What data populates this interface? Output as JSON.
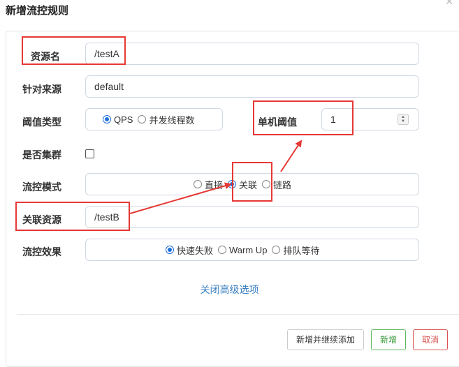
{
  "dialog": {
    "title": "新增流控规则"
  },
  "form": {
    "resource_name": {
      "label": "资源名",
      "value": "/testA"
    },
    "limit_app": {
      "label": "针对来源",
      "value": "default"
    },
    "threshold_type": {
      "label": "阈值类型",
      "options": [
        "QPS",
        "并发线程数"
      ],
      "selected": "QPS"
    },
    "single_threshold": {
      "label": "单机阈值",
      "value": "1"
    },
    "cluster_mode": {
      "label": "是否集群",
      "checked": false
    },
    "flow_mode": {
      "label": "流控模式",
      "options": [
        "直接",
        "关联",
        "链路"
      ],
      "selected": "关联"
    },
    "ref_resource": {
      "label": "关联资源",
      "value": "/testB"
    },
    "flow_effect": {
      "label": "流控效果",
      "options": [
        "快速失败",
        "Warm Up",
        "排队等待"
      ],
      "selected": "快速失败"
    }
  },
  "advanced_link": "关闭高级选项",
  "buttons": {
    "save_continue": "新增并继续添加",
    "add": "新增",
    "cancel": "取消"
  },
  "annotation": {
    "color": "#e53935"
  }
}
